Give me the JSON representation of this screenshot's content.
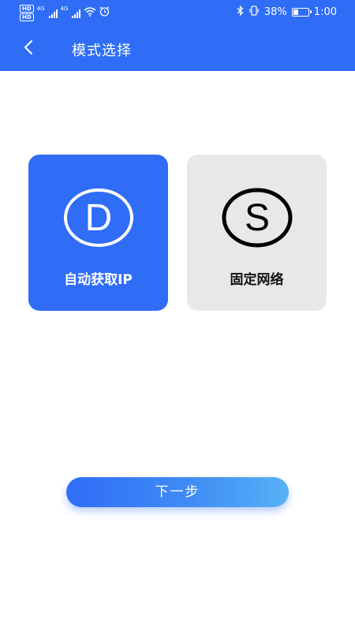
{
  "status_bar": {
    "hd_labels": [
      "HD",
      "HD"
    ],
    "network_labels": [
      "4G",
      "4G"
    ],
    "icons": [
      "signal-icon",
      "signal-icon",
      "wifi-icon",
      "alarm-icon",
      "bluetooth-icon",
      "vibrate-icon",
      "battery-icon"
    ],
    "battery_percent_text": "38%",
    "battery_level": 0.38,
    "time": "1:00"
  },
  "header": {
    "back_icon": "chevron-left-icon",
    "title": "模式选择",
    "background_color": "#2f6df6"
  },
  "modes": [
    {
      "icon": "letter-d-circle-icon",
      "icon_letter": "D",
      "label": "自动获取IP",
      "selected": true
    },
    {
      "icon": "letter-s-circle-icon",
      "icon_letter": "S",
      "label": "固定网络",
      "selected": false
    }
  ],
  "footer": {
    "next_label": "下一步"
  },
  "colors": {
    "accent": "#2f6df6",
    "card_inactive": "#e8e8e8"
  }
}
